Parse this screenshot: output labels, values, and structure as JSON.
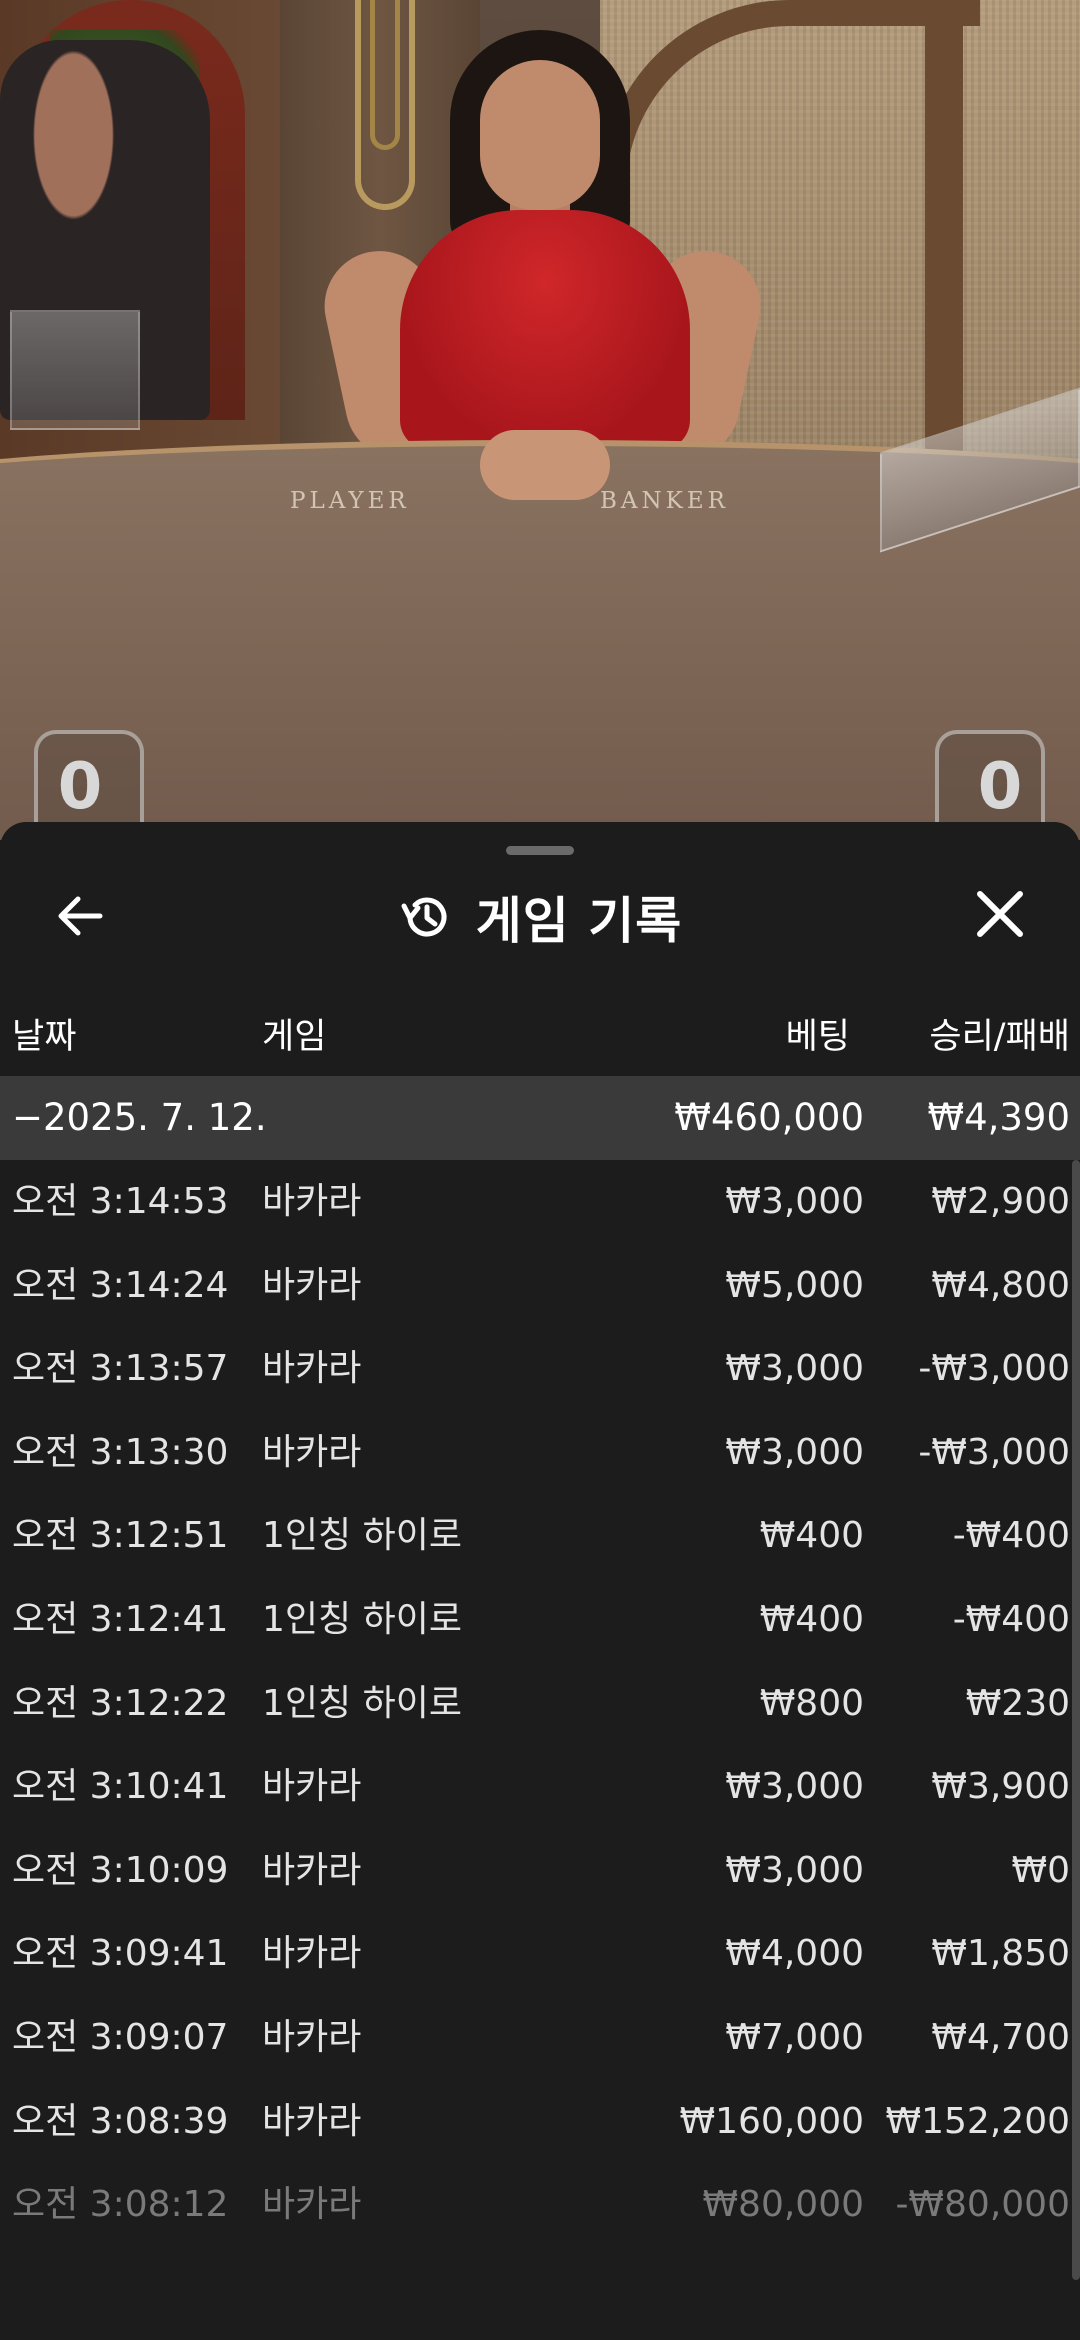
{
  "video": {
    "table_labels": {
      "player": "PLAYER",
      "banker": "BANKER"
    },
    "scores": {
      "player": "0",
      "banker": "0"
    }
  },
  "sheet": {
    "title": "게임 기록",
    "icons": {
      "back": "arrow-left-icon",
      "history": "history-icon",
      "close": "close-icon"
    },
    "columns": {
      "date": "날짜",
      "game": "게임",
      "bet": "베팅",
      "win_loss": "승리/패배"
    },
    "summary": {
      "date": "−2025. 7. 12.",
      "bet": "₩460,000",
      "win_loss": "₩4,390"
    },
    "rows": [
      {
        "time": "오전 3:14:53",
        "game": "바카라",
        "bet": "₩3,000",
        "win_loss": "₩2,900"
      },
      {
        "time": "오전 3:14:24",
        "game": "바카라",
        "bet": "₩5,000",
        "win_loss": "₩4,800"
      },
      {
        "time": "오전 3:13:57",
        "game": "바카라",
        "bet": "₩3,000",
        "win_loss": "-₩3,000"
      },
      {
        "time": "오전 3:13:30",
        "game": "바카라",
        "bet": "₩3,000",
        "win_loss": "-₩3,000"
      },
      {
        "time": "오전 3:12:51",
        "game": "1인칭 하이로",
        "bet": "₩400",
        "win_loss": "-₩400"
      },
      {
        "time": "오전 3:12:41",
        "game": "1인칭 하이로",
        "bet": "₩400",
        "win_loss": "-₩400"
      },
      {
        "time": "오전 3:12:22",
        "game": "1인칭 하이로",
        "bet": "₩800",
        "win_loss": "₩230"
      },
      {
        "time": "오전 3:10:41",
        "game": "바카라",
        "bet": "₩3,000",
        "win_loss": "₩3,900"
      },
      {
        "time": "오전 3:10:09",
        "game": "바카라",
        "bet": "₩3,000",
        "win_loss": "₩0"
      },
      {
        "time": "오전 3:09:41",
        "game": "바카라",
        "bet": "₩4,000",
        "win_loss": "₩1,850"
      },
      {
        "time": "오전 3:09:07",
        "game": "바카라",
        "bet": "₩7,000",
        "win_loss": "₩4,700"
      },
      {
        "time": "오전 3:08:39",
        "game": "바카라",
        "bet": "₩160,000",
        "win_loss": "₩152,200"
      },
      {
        "time": "오전 3:08:12",
        "game": "바카라",
        "bet": "₩80,000",
        "win_loss": "-₩80,000"
      }
    ]
  }
}
